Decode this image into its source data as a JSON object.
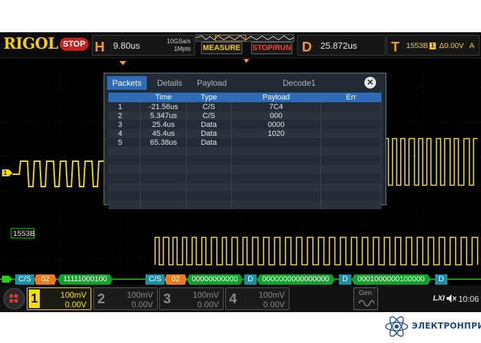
{
  "brand": "RIGOL",
  "run_state": "STOP",
  "timebase": {
    "letter": "H",
    "value": "9.80us",
    "sample_rate": "10GSa/s",
    "memory": "1Mpts"
  },
  "buttons": {
    "measure": "MEASURE",
    "stop_run": "STOP/RUN"
  },
  "delay": {
    "letter": "D",
    "value": "25.872us"
  },
  "trigger": {
    "letter": "T",
    "source": "1553B",
    "channel": "1",
    "level": "Δ0.00V",
    "mode": "A"
  },
  "decode_window": {
    "tabs": [
      "Packets",
      "Details",
      "Payload"
    ],
    "title": "Decode1",
    "columns": [
      "Time",
      "Type",
      "Payload",
      "Err"
    ],
    "rows": [
      {
        "num": "1",
        "time": "-21.56us",
        "type": "C/S",
        "payload": "7C4",
        "err": ""
      },
      {
        "num": "2",
        "time": "5.347us",
        "type": "C/S",
        "payload": "000",
        "err": ""
      },
      {
        "num": "3",
        "time": "25.4us",
        "type": "Data",
        "payload": "0000",
        "err": ""
      },
      {
        "num": "4",
        "time": "45.4us",
        "type": "Data",
        "payload": "1020",
        "err": ""
      },
      {
        "num": "5",
        "time": "65.38us",
        "type": "Data",
        "payload": "",
        "err": ""
      }
    ]
  },
  "bus": {
    "label": "1553B",
    "segments": [
      "C/S",
      "02",
      "11111000100",
      "C/S",
      "02",
      "00000000000",
      "D",
      "0000000000000000",
      "D",
      "0001000000100000",
      "D"
    ]
  },
  "channel_marker": "1",
  "channels": [
    {
      "num": "1",
      "scale": "100mV",
      "offset": "0.00V"
    },
    {
      "num": "2",
      "scale": "100mV",
      "offset": "0.00V"
    },
    {
      "num": "3",
      "scale": "100mV",
      "offset": "0.00V"
    },
    {
      "num": "4",
      "scale": "100mV",
      "offset": "0.00V"
    }
  ],
  "gen_label": "Gen",
  "status": {
    "lxi": "LXI",
    "time": "10:06"
  },
  "footer_brand": "ЭЛЕКТРОНПРИБОР",
  "colors": {
    "ch1": "#f5e000",
    "bus": "#1bd800",
    "accent": "#f39c1a",
    "decode_tab": "#2f6cb6"
  }
}
